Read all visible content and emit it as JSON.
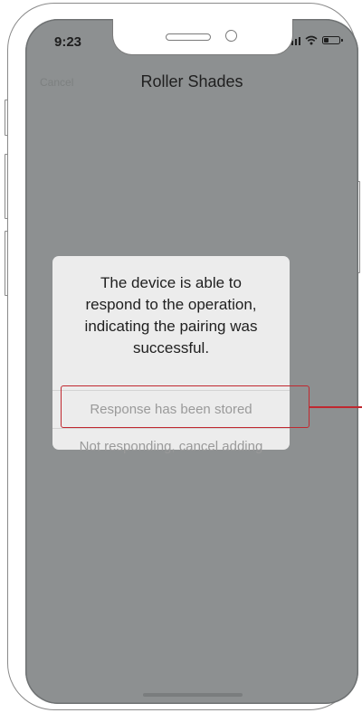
{
  "status_bar": {
    "time": "9:23",
    "icons": [
      "signal-icon",
      "wifi-icon",
      "battery-icon"
    ]
  },
  "nav": {
    "cancel_label": "Cancel",
    "title": "Roller Shades"
  },
  "dialog": {
    "message": "The device is able to respond to the operation, indicating the pairing was successful.",
    "options": [
      {
        "label": "Response has been stored",
        "highlighted": true
      },
      {
        "label": "Not responding, cancel adding",
        "highlighted": false
      }
    ]
  },
  "annotation": {
    "highlight_color": "#c0282f"
  },
  "colors": {
    "overlay": "#8d9091",
    "dialog_bg": "#ececec",
    "option_text": "#9a9a9a"
  }
}
